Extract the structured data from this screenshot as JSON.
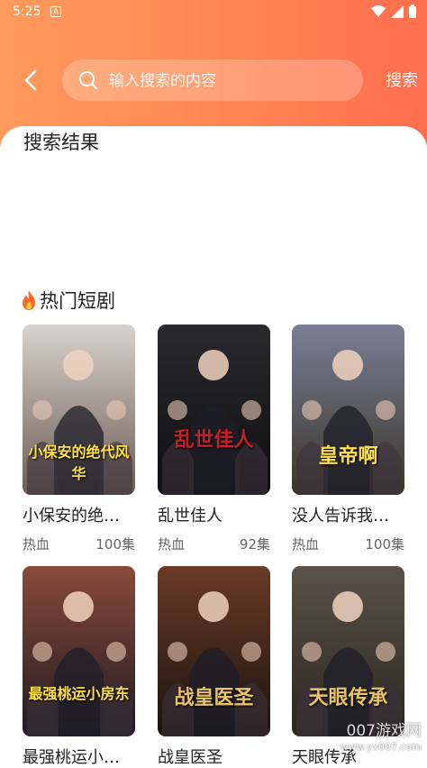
{
  "status_bar": {
    "time": "5:25",
    "notification_icon": "A"
  },
  "header": {
    "search_placeholder": "输入搜索的内容",
    "search_button": "搜索"
  },
  "results_section": {
    "title": "搜索结果"
  },
  "hot_section": {
    "title": "热门短剧",
    "items": [
      {
        "title": "小保安的绝…",
        "genre": "热血",
        "episodes": "100集",
        "poster_text": "小保安的绝代风华",
        "colors": [
          "#d9d2cc",
          "#6a5c55"
        ]
      },
      {
        "title": "乱世佳人",
        "genre": "热血",
        "episodes": "92集",
        "poster_text": "乱世佳人",
        "colors": [
          "#2a2a2e",
          "#0e0e10"
        ]
      },
      {
        "title": "没人告诉我…",
        "genre": "热血",
        "episodes": "100集",
        "poster_text": "皇帝啊",
        "colors": [
          "#7a7f97",
          "#3a3428"
        ]
      },
      {
        "title": "最强桃运小…",
        "genre": "",
        "episodes": "",
        "poster_text": "最强桃运小房东",
        "colors": [
          "#8a4a3a",
          "#1e1a22"
        ]
      },
      {
        "title": "战皇医圣",
        "genre": "",
        "episodes": "",
        "poster_text": "战皇医圣",
        "colors": [
          "#6a3a25",
          "#1a1410"
        ]
      },
      {
        "title": "天眼传承",
        "genre": "",
        "episodes": "",
        "poster_text": "天眼传承",
        "colors": [
          "#5a5248",
          "#2a2620"
        ]
      }
    ]
  },
  "watermark": {
    "line1": "007游戏网",
    "line2": "www.yx007.com"
  }
}
